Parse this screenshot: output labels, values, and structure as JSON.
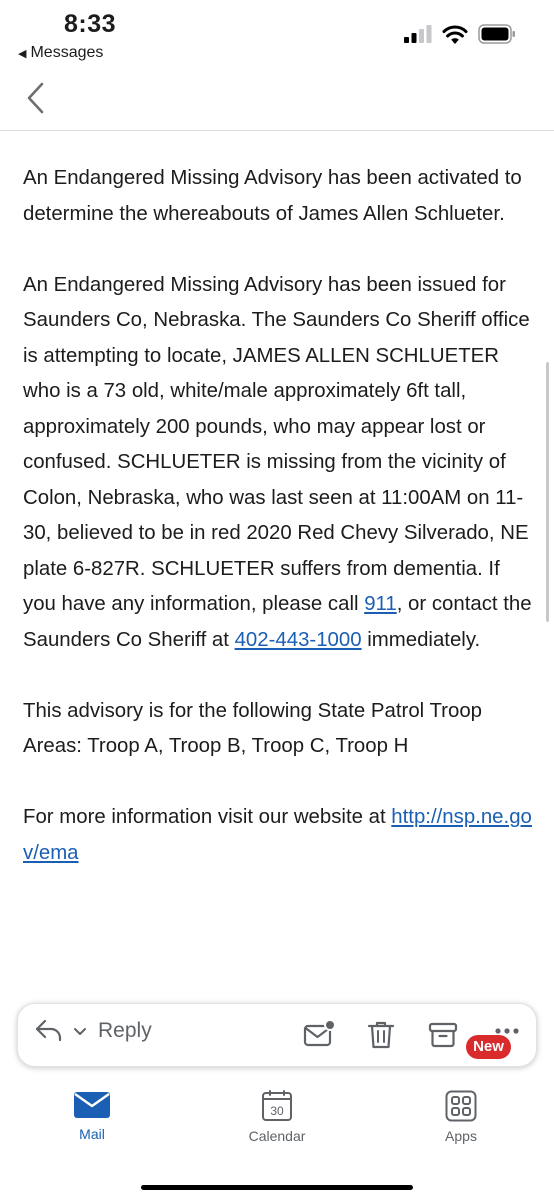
{
  "status_bar": {
    "time": "8:33",
    "back_app": "Messages"
  },
  "email": {
    "paragraphs": {
      "p1": "An Endangered Missing Advisory has been activated to determine the whereabouts of James Allen Schlueter.",
      "p2_a": "An Endangered Missing Advisory has been issued for Saunders Co, Nebraska. The Saunders Co Sheriff office is attempting to locate, JAMES ALLEN SCHLUETER who is a 73 old, white/male approximately 6ft tall, approximately 200 pounds, who may appear lost or confused. SCHLUETER is missing from the vicinity of Colon, Nebraska, who was last seen at 11:00AM on 11-30, believed to be in red 2020 Red Chevy Silverado, NE plate 6-827R. SCHLUETER suffers from dementia. If you have any information, please call ",
      "p2_link1": "911",
      "p2_b": ", or contact the Saunders Co Sheriff at ",
      "p2_link2": "402-443-1000",
      "p2_c": " immediately.",
      "p3": "This advisory is for the following State Patrol Troop Areas: Troop A, Troop B, Troop C, Troop H",
      "p4_a": "For more information visit our website at ",
      "p4_link": "http://nsp.ne.gov/ema"
    }
  },
  "action_bar": {
    "reply_label": "Reply",
    "new_badge": "New"
  },
  "tabs": [
    {
      "label": "Mail",
      "icon": "mail-icon",
      "active": true
    },
    {
      "label": "Calendar",
      "icon": "calendar-icon",
      "calendar_day": "30"
    },
    {
      "label": "Apps",
      "icon": "apps-icon"
    }
  ],
  "colors": {
    "accent": "#1a5fb4",
    "badge": "#d92b2b",
    "text": "#1c1c1e",
    "icon_gray": "#5f6368"
  }
}
